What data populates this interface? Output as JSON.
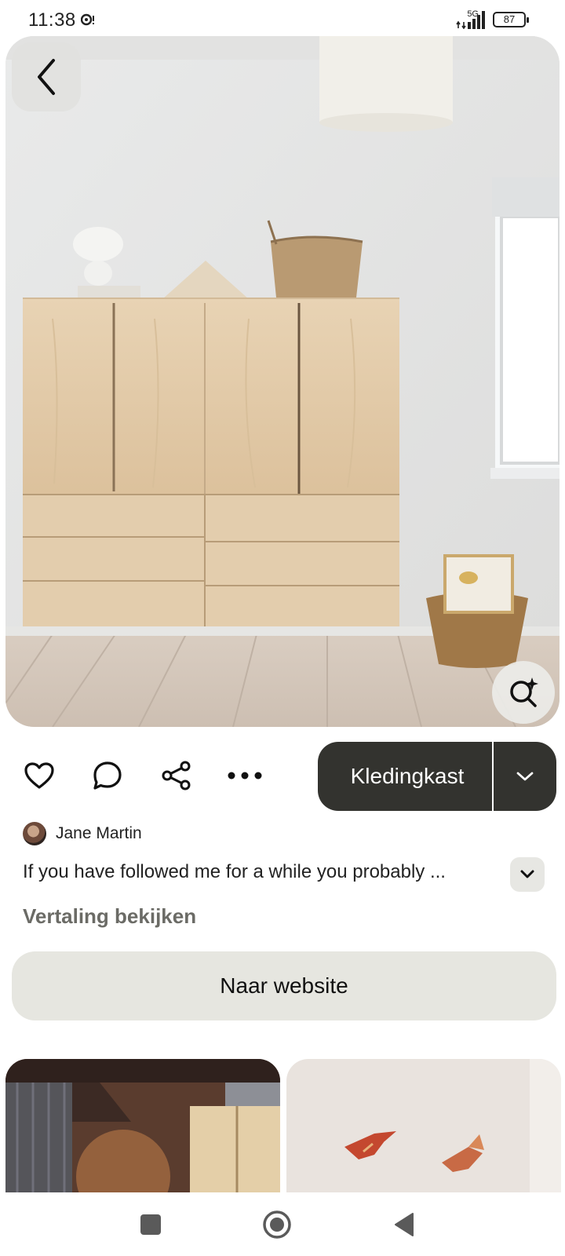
{
  "status_bar": {
    "time": "11:38",
    "network": "5G",
    "battery": "87"
  },
  "pin": {
    "image_alt": "Wooden pine cabinet with drawers in a bright room",
    "board_name": "Kledingkast",
    "author_name": "Jane Martin",
    "description": "If you have followed me for a while you probably ...",
    "translate_label": "Vertaling bekijken",
    "website_label": "Naar website"
  },
  "icons": {
    "back": "chevron-left-icon",
    "visual_search": "visual-search-icon",
    "like": "heart-icon",
    "comment": "comment-icon",
    "share": "share-icon",
    "more": "more-icon",
    "dropdown": "chevron-down-icon"
  },
  "colors": {
    "board_pill": "#33332f",
    "website_button": "#e6e6e0",
    "translate_text": "#6b6b66"
  }
}
